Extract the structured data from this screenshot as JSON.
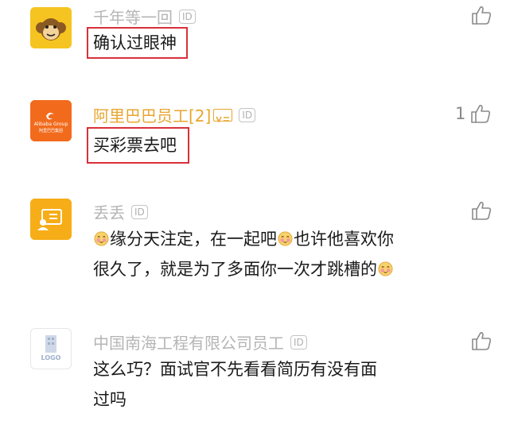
{
  "comments": [
    {
      "username": "千年等一回",
      "id_badge": "ID",
      "text": "确认过眼神",
      "likes": ""
    },
    {
      "username": "阿里巴巴员工[2]",
      "id_badge": "ID",
      "text": "买彩票去吧",
      "likes": "1",
      "avatar_brand": "Alibaba Group",
      "avatar_subtext": "阿里巴巴集团"
    },
    {
      "username": "丢丢",
      "id_badge": "ID",
      "text_line1": "缘分天注定，在一起吧",
      "text_line1b": "也许他喜欢你",
      "text_line2": "很久了，就是为了多面你一次才跳槽的",
      "likes": ""
    },
    {
      "username": "中国南海工程有限公司员工",
      "id_badge": "ID",
      "text_line1": "这么巧？面试官不先看看简历有没有面",
      "text_line2": "过吗",
      "likes": "",
      "avatar_logo": "LOGO"
    }
  ],
  "colors": {
    "accent_red": "#d9303a",
    "gold": "#e8a52e",
    "grey_name": "#b5b5b5"
  }
}
